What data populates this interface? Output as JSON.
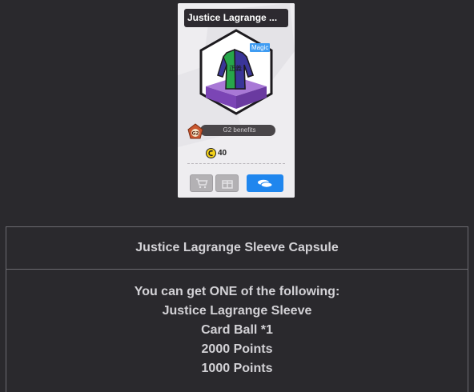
{
  "item_card": {
    "title": "Justice Lagrange ...",
    "badge": "Magic",
    "benefits_label": "G2 benefits",
    "price": "40",
    "jacket_text": "正義",
    "colors": {
      "title_bg": "#2d2a30",
      "badge": "#3f9cf2",
      "try_button": "#1f86ee",
      "jacket_green": "#27a64a",
      "jacket_purple": "#3a3598",
      "pedestal": "#8c55c7"
    },
    "icons": {
      "g2": "g2-badge-icon",
      "coin": "coin-icon",
      "cart": "shopping-cart-icon",
      "gift": "gift-box-icon",
      "try_on": "capsule-icon"
    }
  },
  "details": {
    "title": "Justice Lagrange Sleeve Capsule",
    "intro": "You can get ONE of the following:",
    "items": [
      "Justice Lagrange Sleeve",
      "Card Ball *1",
      "2000 Points",
      "1000 Points"
    ]
  }
}
